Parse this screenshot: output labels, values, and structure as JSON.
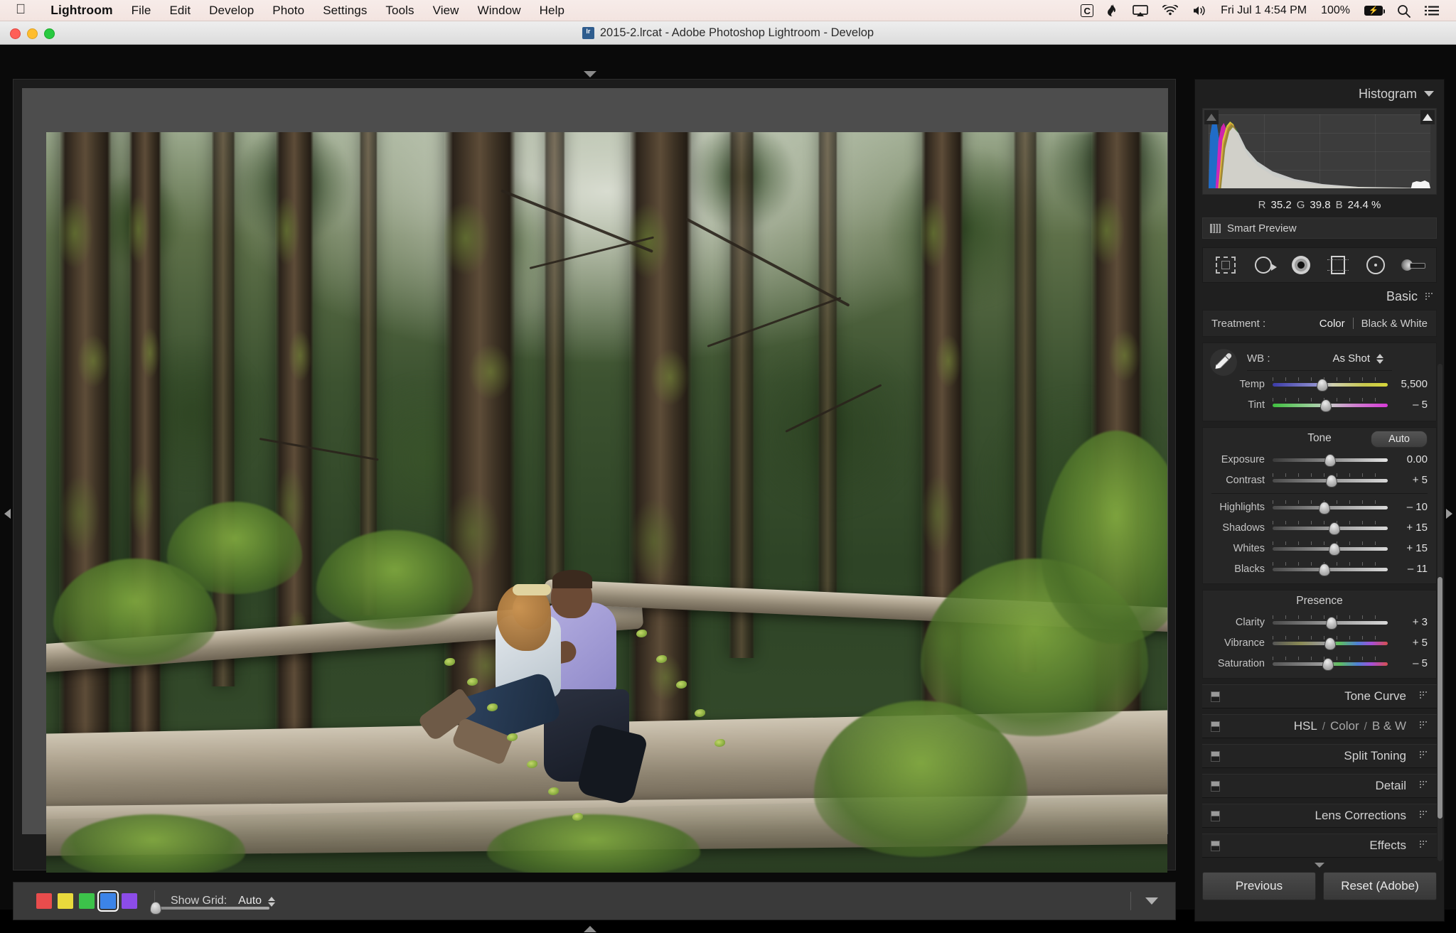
{
  "menubar": {
    "apple_icon": "apple-logo-icon",
    "items": [
      "Lightroom",
      "File",
      "Edit",
      "Develop",
      "Photo",
      "Settings",
      "Tools",
      "View",
      "Window",
      "Help"
    ],
    "status": {
      "c_badge": "C",
      "flame_icon": "flame-icon",
      "airplay_icon": "airplay-icon",
      "wifi_icon": "wifi-icon",
      "volume_icon": "volume-icon",
      "datetime": "Fri Jul 1  4:54 PM",
      "battery_percent": "100%",
      "battery_icon": "battery-charging-icon",
      "search_icon": "search-icon",
      "list_icon": "notification-center-icon"
    }
  },
  "window": {
    "title": "2015-2.lrcat - Adobe Photoshop Lightroom - Develop",
    "doc_icon": "lrcat-document-icon",
    "close_label": "close",
    "minimize_label": "minimize",
    "zoom_label": "zoom"
  },
  "image": {
    "alt": "Couple embracing seated on a fallen log in a dense evergreen forest"
  },
  "toolbar": {
    "swatches": [
      {
        "name": "red",
        "color": "#e84c4c",
        "selected": false
      },
      {
        "name": "yellow",
        "color": "#e8d93c",
        "selected": false
      },
      {
        "name": "green",
        "color": "#3cc24a",
        "selected": false
      },
      {
        "name": "blue",
        "color": "#3c84e8",
        "selected": true
      },
      {
        "name": "purple",
        "color": "#8c4ce8",
        "selected": false
      }
    ],
    "show_grid_label": "Show Grid:",
    "show_grid_value": "Auto",
    "grid_slider_value": 0,
    "chevron_icon": "chevron-down-icon"
  },
  "right_panel": {
    "histogram": {
      "title": "Histogram",
      "collapse_icon": "triangle-down-icon",
      "shadow_clip_icon": "shadow-clipping-icon",
      "highlight_clip_icon": "highlight-clipping-icon",
      "readout": {
        "r_label": "R",
        "r_value": "35.2",
        "g_label": "G",
        "g_value": "39.8",
        "b_label": "B",
        "b_value": "24.4 %"
      },
      "smart_preview": "Smart Preview",
      "smart_preview_icon": "smart-preview-icon"
    },
    "tools": [
      {
        "name": "crop-overlay-tool",
        "label": "Crop Overlay"
      },
      {
        "name": "spot-removal-tool",
        "label": "Spot Removal"
      },
      {
        "name": "red-eye-correction-tool",
        "label": "Red Eye Correction"
      },
      {
        "name": "graduated-filter-tool",
        "label": "Graduated Filter"
      },
      {
        "name": "radial-filter-tool",
        "label": "Radial Filter"
      },
      {
        "name": "adjustment-brush-tool",
        "label": "Adjustment Brush"
      }
    ],
    "basic": {
      "title": "Basic",
      "fan_icon": "switch-fan-icon",
      "treatment_label": "Treatment :",
      "treatment_options": [
        "Color",
        "Black & White"
      ],
      "treatment_selected": "Color",
      "eyedropper_icon": "white-balance-selector-icon",
      "wb_label": "WB :",
      "wb_value": "As Shot",
      "wb_stepper_icon": "stepper-updown-icon",
      "wb_sliders": [
        {
          "label": "Temp",
          "value": "5,500",
          "pos": 43
        },
        {
          "label": "Tint",
          "value": "– 5",
          "pos": 46
        }
      ],
      "tone_title": "Tone",
      "auto_label": "Auto",
      "tone_sliders": [
        {
          "label": "Exposure",
          "value": "0.00",
          "pos": 50
        },
        {
          "label": "Contrast",
          "value": "+ 5",
          "pos": 51
        },
        {
          "label": "Highlights",
          "value": "– 10",
          "pos": 45
        },
        {
          "label": "Shadows",
          "value": "+ 15",
          "pos": 54
        },
        {
          "label": "Whites",
          "value": "+ 15",
          "pos": 54
        },
        {
          "label": "Blacks",
          "value": "– 11",
          "pos": 45
        }
      ],
      "presence_title": "Presence",
      "presence_sliders": [
        {
          "label": "Clarity",
          "value": "+ 3",
          "pos": 51
        },
        {
          "label": "Vibrance",
          "value": "+ 5",
          "pos": 50
        },
        {
          "label": "Saturation",
          "value": "– 5",
          "pos": 48
        }
      ]
    },
    "collapsed_panels": [
      {
        "title": "Tone Curve",
        "parts": null
      },
      {
        "title": null,
        "parts": [
          "HSL",
          "/",
          "Color",
          "/",
          "B & W"
        ]
      },
      {
        "title": "Split Toning",
        "parts": null
      },
      {
        "title": "Detail",
        "parts": null
      },
      {
        "title": "Lens Corrections",
        "parts": null
      },
      {
        "title": "Effects",
        "parts": null
      }
    ],
    "buttons": {
      "previous": "Previous",
      "reset": "Reset (Adobe)"
    }
  }
}
